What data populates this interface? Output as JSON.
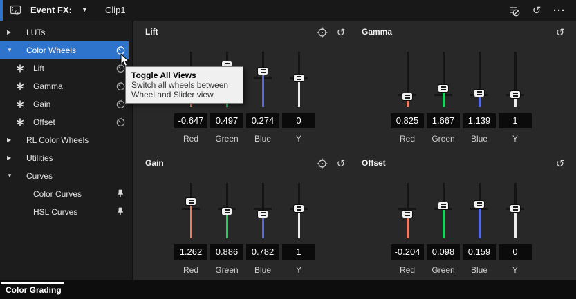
{
  "titlebar": {
    "label": "Event FX:",
    "clip": "Clip1",
    "caret": "▼",
    "icons": [
      "fx-bypass",
      "reset",
      "more-options"
    ]
  },
  "sidebar": {
    "items": [
      {
        "label": "LUTs",
        "indent": 1,
        "arrow": "collapsed"
      },
      {
        "label": "Color Wheels",
        "indent": 1,
        "arrow": "expanded",
        "selected": true,
        "right_icon": "wheel-toggle"
      },
      {
        "label": "Lift",
        "indent": 2,
        "lead_icon": "asterisk",
        "right_icon": "clock"
      },
      {
        "label": "Gamma",
        "indent": 2,
        "lead_icon": "asterisk",
        "right_icon": "clock"
      },
      {
        "label": "Gain",
        "indent": 2,
        "lead_icon": "asterisk",
        "right_icon": "clock"
      },
      {
        "label": "Offset",
        "indent": 2,
        "lead_icon": "asterisk",
        "right_icon": "clock"
      },
      {
        "label": "RL Color Wheels",
        "indent": 1,
        "arrow": "collapsed"
      },
      {
        "label": "Utilities",
        "indent": 1,
        "arrow": "collapsed"
      },
      {
        "label": "Curves",
        "indent": 1,
        "arrow": "expanded"
      },
      {
        "label": "Color Curves",
        "indent": 2,
        "right_icon": "pin"
      },
      {
        "label": "HSL Curves",
        "indent": 2,
        "right_icon": "pin"
      }
    ]
  },
  "tooltip": {
    "title": "Toggle All Views",
    "body1": "Switch all wheels between",
    "body2": "Wheel and Slider view."
  },
  "quadrants": [
    {
      "title": "Lift",
      "icons": [
        "pick",
        "reset"
      ],
      "scale": "linear",
      "neutral": 0,
      "sliders": [
        {
          "label": "Red",
          "value": -0.647,
          "display": "-0.647",
          "color": "#ee7a62"
        },
        {
          "label": "Green",
          "value": 0.497,
          "display": "0.497",
          "color": "#1ed05e"
        },
        {
          "label": "Blue",
          "value": 0.274,
          "display": "0.274",
          "color": "#5468e4"
        },
        {
          "label": "Y",
          "value": 0,
          "display": "0",
          "color": "#ececec"
        }
      ]
    },
    {
      "title": "Gamma",
      "icons": [
        "reset"
      ],
      "scale": "log",
      "neutral": 1,
      "sliders": [
        {
          "label": "Red",
          "value": 0.825,
          "display": "0.825",
          "color": "#ee7a62"
        },
        {
          "label": "Green",
          "value": 1.667,
          "display": "1.667",
          "color": "#1ed05e"
        },
        {
          "label": "Blue",
          "value": 1.139,
          "display": "1.139",
          "color": "#5468e4"
        },
        {
          "label": "Y",
          "value": 1,
          "display": "1",
          "color": "#ececec"
        }
      ]
    },
    {
      "title": "Gain",
      "icons": [
        "pick",
        "reset"
      ],
      "scale": "linear",
      "neutral": 1,
      "sliders": [
        {
          "label": "Red",
          "value": 1.262,
          "display": "1.262",
          "color": "#ee7a62"
        },
        {
          "label": "Green",
          "value": 0.886,
          "display": "0.886",
          "color": "#1ed05e"
        },
        {
          "label": "Blue",
          "value": 0.782,
          "display": "0.782",
          "color": "#5468e4"
        },
        {
          "label": "Y",
          "value": 1,
          "display": "1",
          "color": "#ececec"
        }
      ]
    },
    {
      "title": "Offset",
      "icons": [
        "reset"
      ],
      "scale": "linear",
      "neutral": 0,
      "sliders": [
        {
          "label": "Red",
          "value": -0.204,
          "display": "-0.204",
          "color": "#ee7a62"
        },
        {
          "label": "Green",
          "value": 0.098,
          "display": "0.098",
          "color": "#1ed05e"
        },
        {
          "label": "Blue",
          "value": 0.159,
          "display": "0.159",
          "color": "#5468e4"
        },
        {
          "label": "Y",
          "value": 0,
          "display": "0",
          "color": "#ececec"
        }
      ]
    }
  ],
  "footer": {
    "tab": "Color Grading"
  },
  "colors": {
    "accent_blue": "#2e73cc",
    "red": "#ee7a62",
    "green": "#1ed05e",
    "blue": "#5468e4"
  }
}
